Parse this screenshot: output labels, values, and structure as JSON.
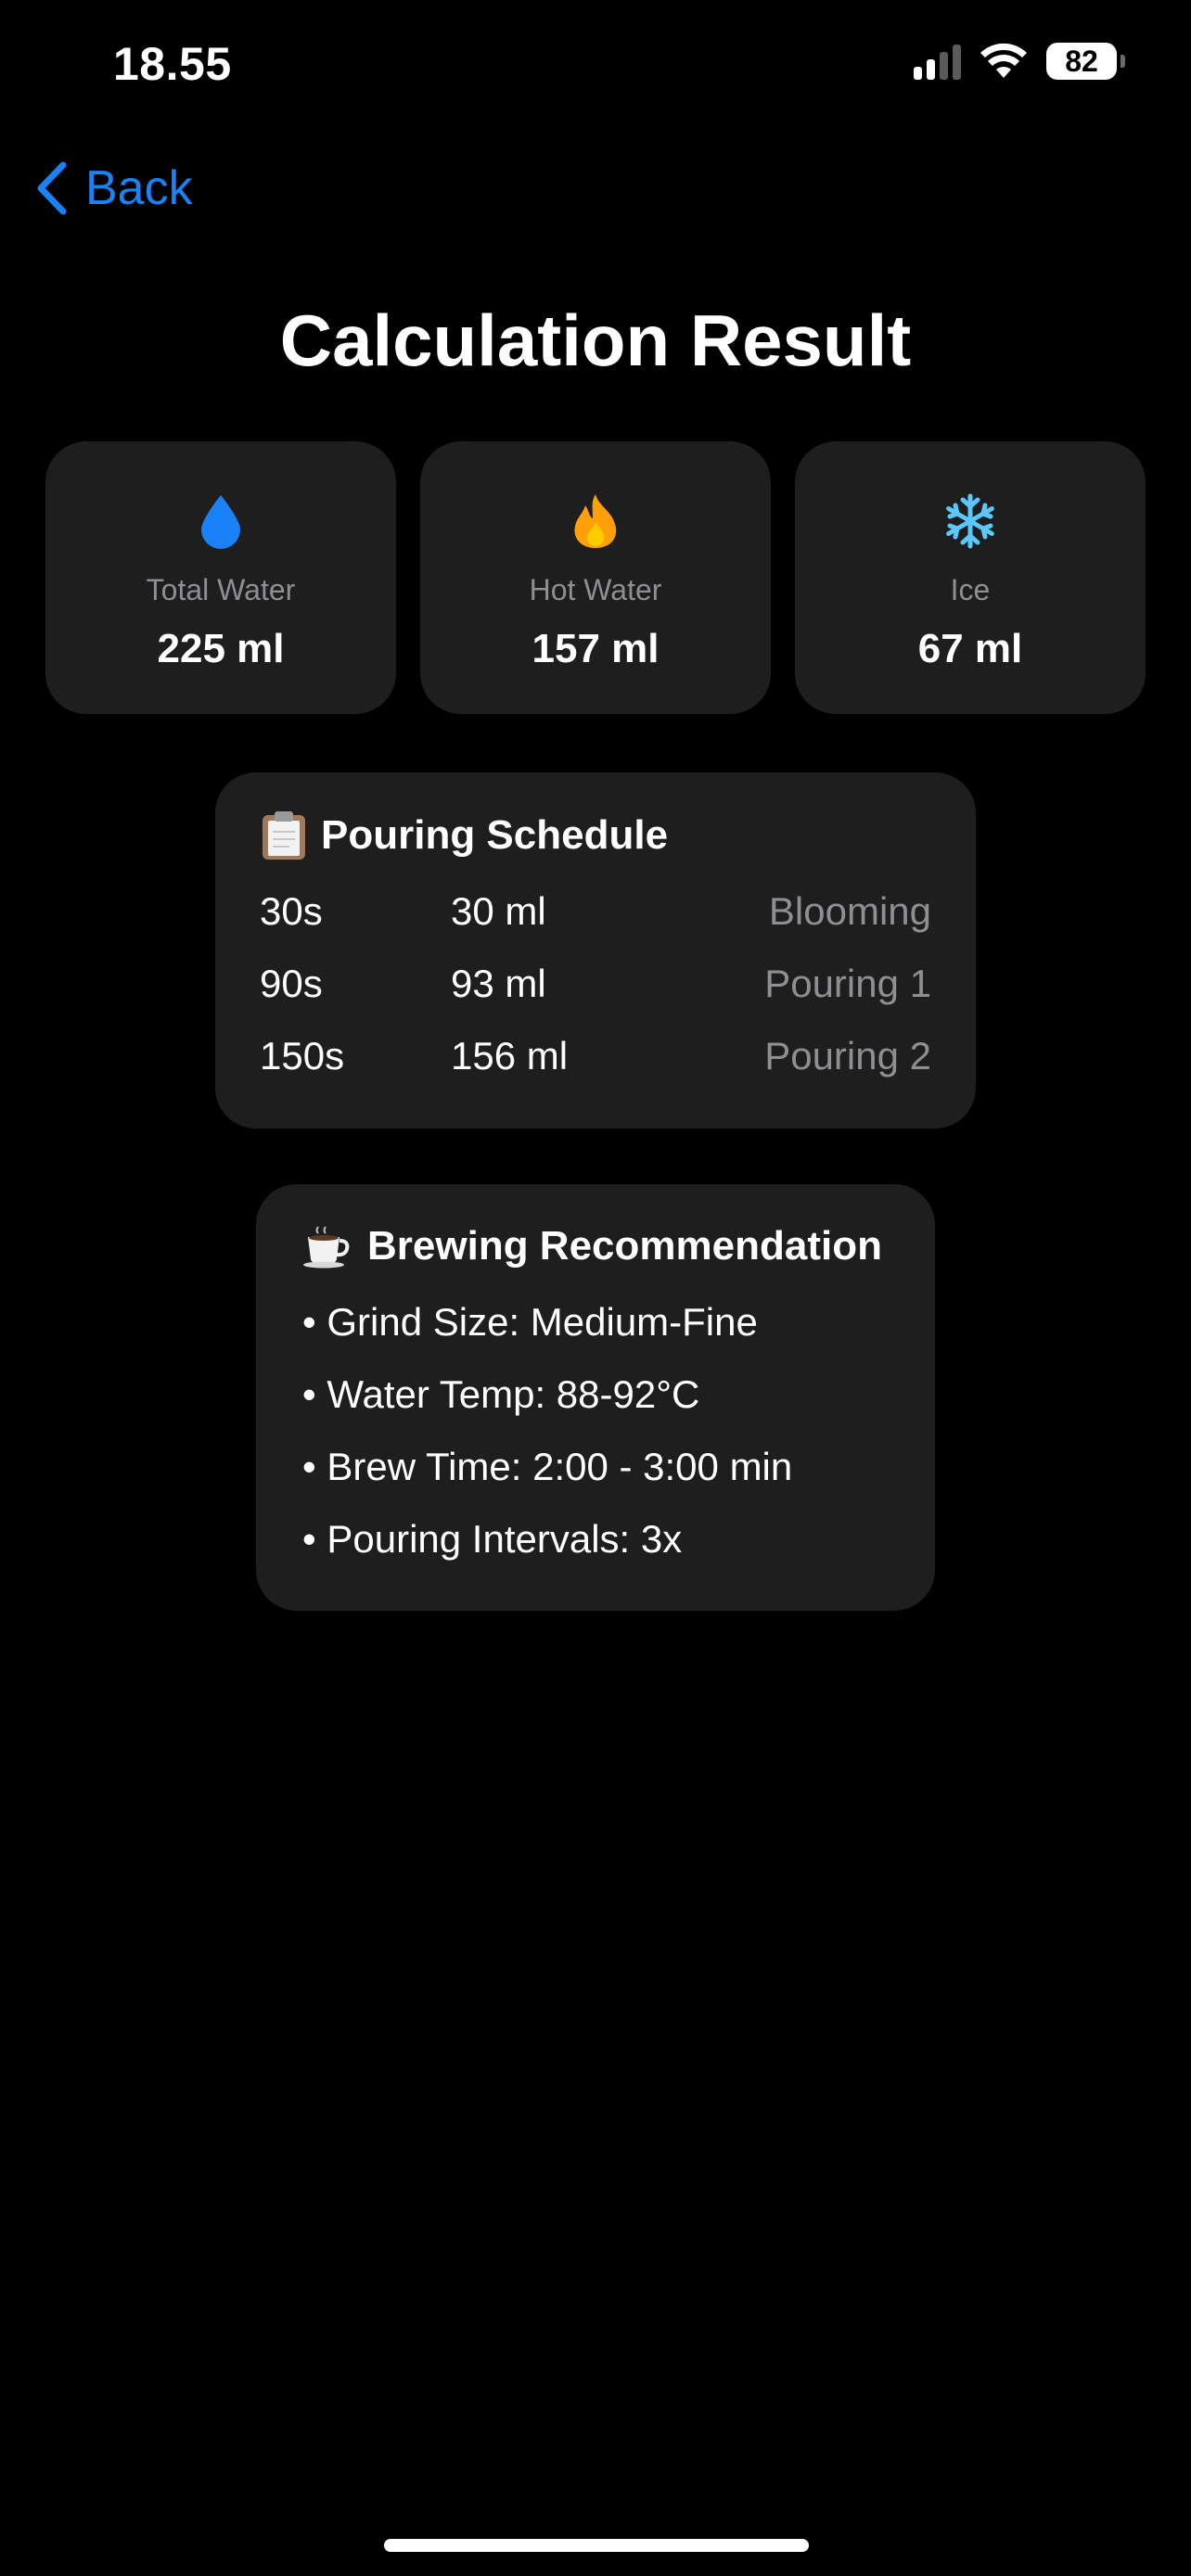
{
  "status_bar": {
    "time": "18.55",
    "battery": "82"
  },
  "nav": {
    "back_label": "Back"
  },
  "page": {
    "title": "Calculation Result"
  },
  "stats": [
    {
      "icon": "water-drop-icon",
      "label": "Total Water",
      "value": "225 ml",
      "color": "#1a82f7"
    },
    {
      "icon": "fire-icon",
      "label": "Hot Water",
      "value": "157 ml",
      "color": "#ff9f0a"
    },
    {
      "icon": "snowflake-icon",
      "label": "Ice",
      "value": "67 ml",
      "color": "#5ac8fa"
    }
  ],
  "pouring_schedule": {
    "icon": "clipboard-icon",
    "title": "Pouring Schedule",
    "rows": [
      {
        "time": "30s",
        "amount": "30 ml",
        "phase": "Blooming"
      },
      {
        "time": "90s",
        "amount": "93 ml",
        "phase": "Pouring 1"
      },
      {
        "time": "150s",
        "amount": "156 ml",
        "phase": "Pouring 2"
      }
    ]
  },
  "recommendation": {
    "icon": "coffee-cup-icon",
    "title": "Brewing Recommendation",
    "items": [
      "• Grind Size: Medium-Fine",
      "• Water Temp: 88-92°C",
      "• Brew Time: 2:00 - 3:00 min",
      "• Pouring Intervals: 3x"
    ]
  },
  "colors": {
    "background": "#000000",
    "card": "#1e1e1e",
    "accent": "#1a82f7",
    "secondary_text": "#8e8e93"
  }
}
